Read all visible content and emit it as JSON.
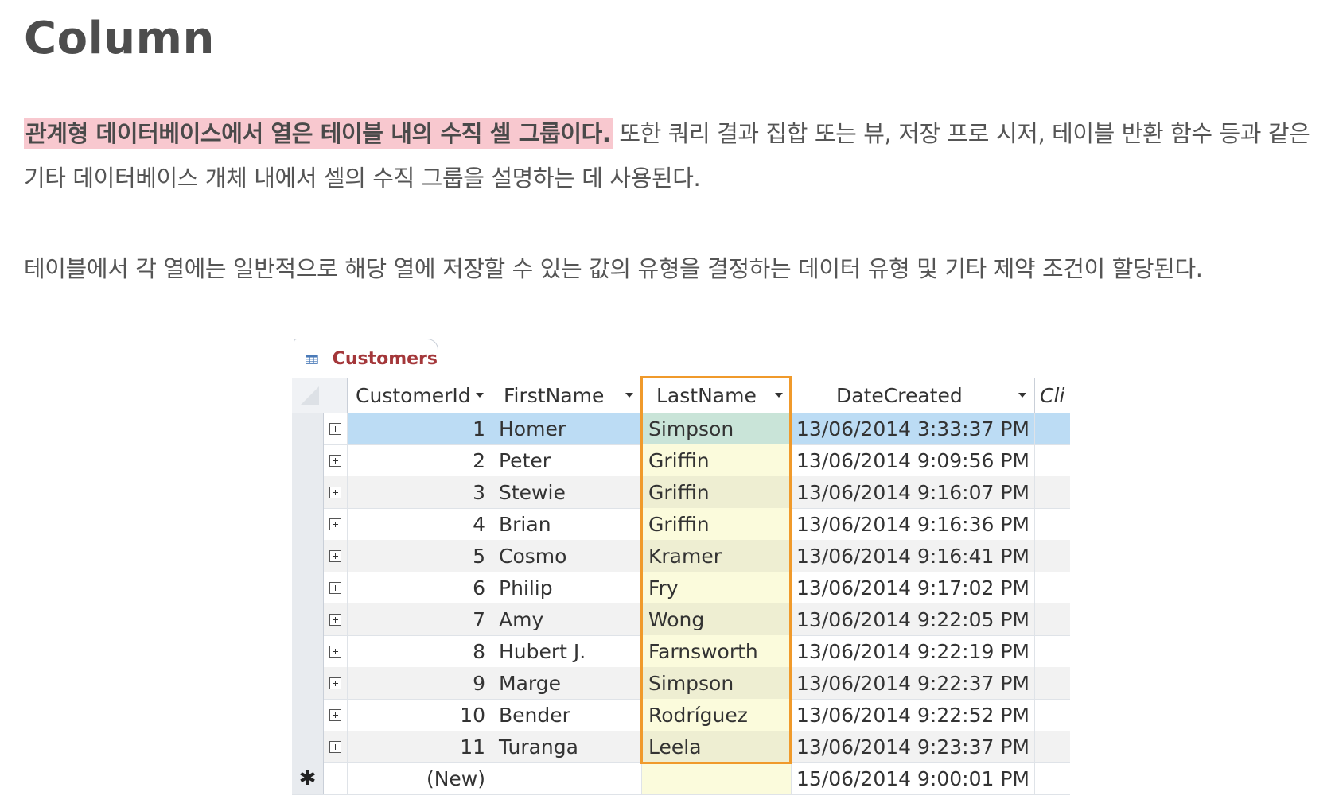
{
  "heading": "Column",
  "paragraph1": {
    "highlight": "관계형 데이터베이스에서 열은 테이블 내의 수직 셀 그룹이다.",
    "rest": " 또한 쿼리 결과 집합 또는 뷰, 저장 프로 시저, 테이블 반환 함수 등과 같은 기타 데이터베이스 개체 내에서 셀의 수직 그룹을 설명하는 데 사용된다."
  },
  "paragraph2": "테이블에서 각 열에는 일반적으로 해당 열에 저장할 수 있는 값의 유형을 결정하는 데이터 유형 및 기타 제약 조건이 할당된다.",
  "table": {
    "tab_label": "Customers",
    "columns": [
      "CustomerId",
      "FirstName",
      "LastName",
      "DateCreated",
      "Cli"
    ],
    "rows": [
      {
        "id": "1",
        "first": "Homer",
        "last": "Simpson",
        "date": "13/06/2014 3:33:37 PM"
      },
      {
        "id": "2",
        "first": "Peter",
        "last": "Griffin",
        "date": "13/06/2014 9:09:56 PM"
      },
      {
        "id": "3",
        "first": "Stewie",
        "last": "Griffin",
        "date": "13/06/2014 9:16:07 PM"
      },
      {
        "id": "4",
        "first": "Brian",
        "last": "Griffin",
        "date": "13/06/2014 9:16:36 PM"
      },
      {
        "id": "5",
        "first": "Cosmo",
        "last": "Kramer",
        "date": "13/06/2014 9:16:41 PM"
      },
      {
        "id": "6",
        "first": "Philip",
        "last": "Fry",
        "date": "13/06/2014 9:17:02 PM"
      },
      {
        "id": "7",
        "first": "Amy",
        "last": "Wong",
        "date": "13/06/2014 9:22:05 PM"
      },
      {
        "id": "8",
        "first": "Hubert J.",
        "last": "Farnsworth",
        "date": "13/06/2014 9:22:19 PM"
      },
      {
        "id": "9",
        "first": "Marge",
        "last": "Simpson",
        "date": "13/06/2014 9:22:37 PM"
      },
      {
        "id": "10",
        "first": "Bender",
        "last": "Rodríguez",
        "date": "13/06/2014 9:22:52 PM"
      },
      {
        "id": "11",
        "first": "Turanga",
        "last": "Leela",
        "date": "13/06/2014 9:23:37 PM"
      }
    ],
    "new_row": {
      "marker": "✱",
      "id": "(New)",
      "first": "",
      "last": "",
      "date": "15/06/2014 9:00:01 PM"
    },
    "selected_row_index": 0,
    "highlighted_column": "LastName",
    "colors": {
      "highlight_outline": "#f09a2b",
      "selected_row": "#bcdcf4",
      "column_fill": "#fbfbdc",
      "text_highlight": "#f8c8cf"
    }
  }
}
